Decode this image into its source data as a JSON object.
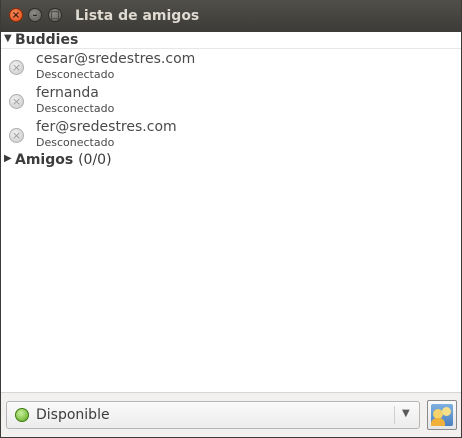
{
  "window": {
    "title": "Lista de amigos",
    "close_glyph": "×",
    "minimize_glyph": "–",
    "maximize_glyph": "□"
  },
  "groups": [
    {
      "name": "Buddies",
      "count": "",
      "expanded": true
    },
    {
      "name": "Amigos",
      "count": "(0/0)",
      "expanded": false
    }
  ],
  "buddies": [
    {
      "name": "cesar@sredestres.com",
      "status": "Desconectado",
      "icon": "offline-icon"
    },
    {
      "name": "fernanda",
      "status": "Desconectado",
      "icon": "offline-icon"
    },
    {
      "name": "fer@sredestres.com",
      "status": "Desconectado",
      "icon": "offline-icon"
    }
  ],
  "status_selector": {
    "value": "Disponible",
    "icon": "available-icon",
    "color": "#5ba81c"
  },
  "icons": {
    "expanded": "▼",
    "collapsed": "▶",
    "dropdown": "▼",
    "offline": "×"
  },
  "colors": {
    "titlebar": "#3c3b37",
    "close_button": "#df4b16"
  }
}
